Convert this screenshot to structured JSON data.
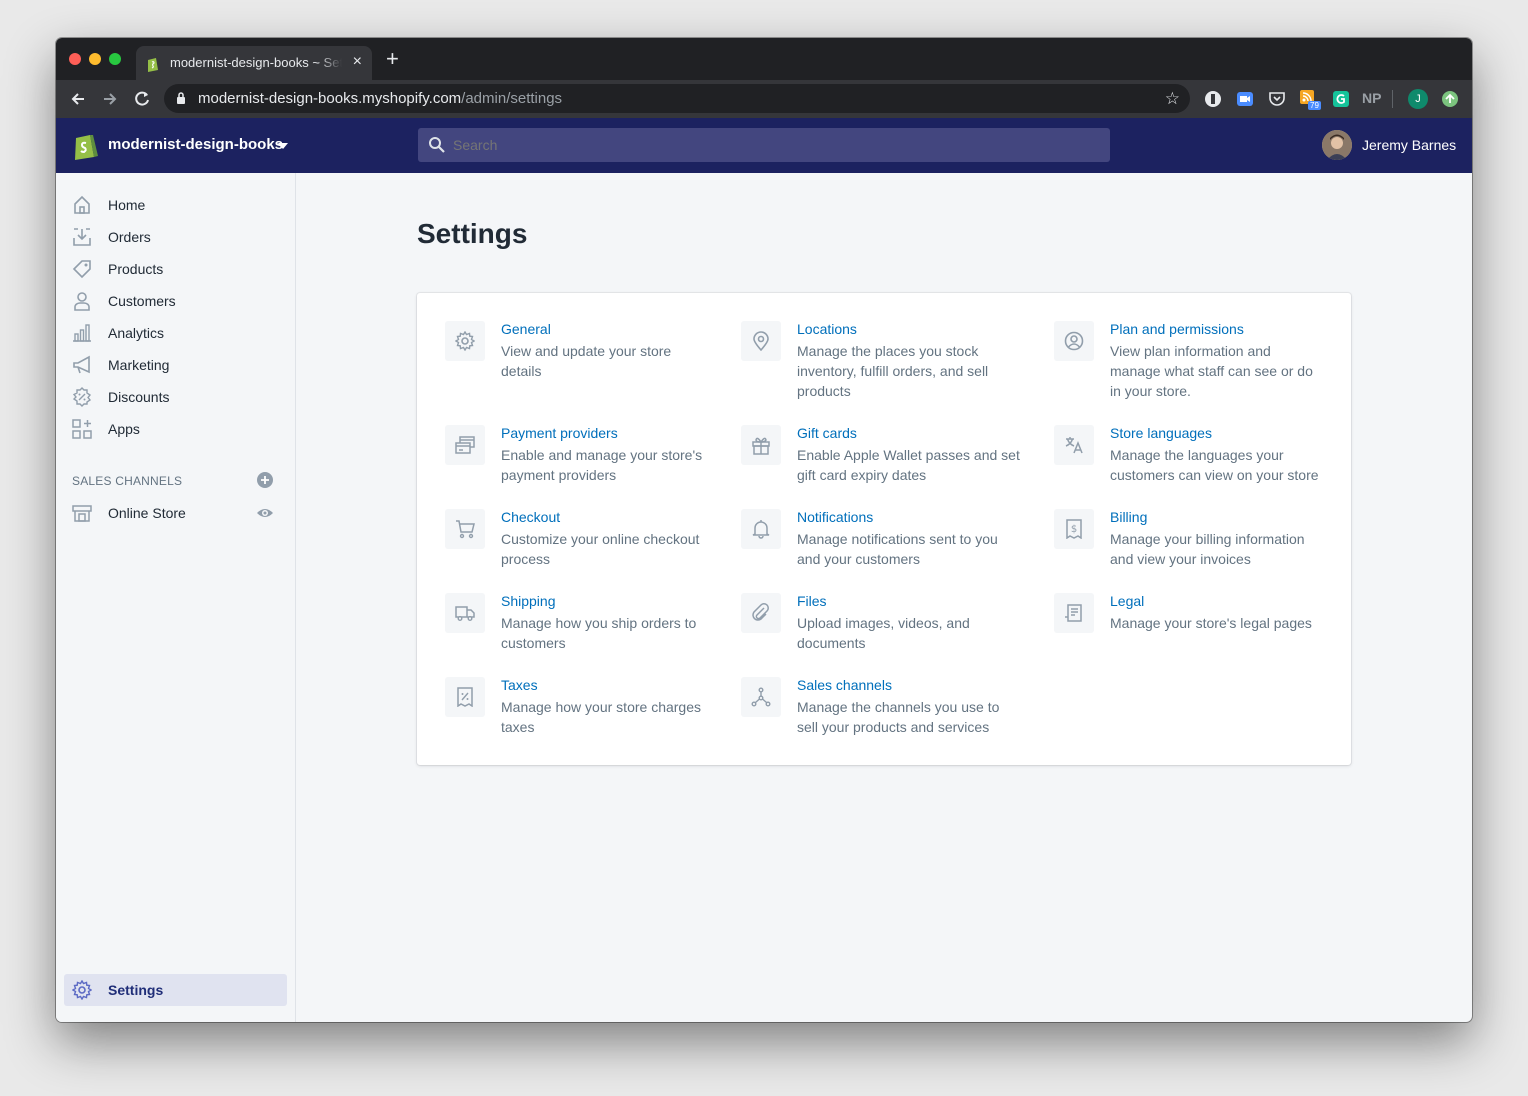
{
  "browser": {
    "tab_title": "modernist-design-books ~ Settings",
    "url_host": "modernist-design-books.myshopify.com",
    "url_path": "/admin/settings",
    "extension_badge": "79",
    "extension_np": "NP",
    "profile_initial": "J"
  },
  "topbar": {
    "store_name": "modernist-design-books",
    "search_placeholder": "Search",
    "user_name": "Jeremy Barnes"
  },
  "sidebar": {
    "items": [
      {
        "label": "Home",
        "icon": "home-icon"
      },
      {
        "label": "Orders",
        "icon": "orders-icon"
      },
      {
        "label": "Products",
        "icon": "tag-icon"
      },
      {
        "label": "Customers",
        "icon": "person-icon"
      },
      {
        "label": "Analytics",
        "icon": "bar-chart-icon"
      },
      {
        "label": "Marketing",
        "icon": "megaphone-icon"
      },
      {
        "label": "Discounts",
        "icon": "discount-icon"
      },
      {
        "label": "Apps",
        "icon": "apps-icon"
      }
    ],
    "sales_channels_heading": "SALES CHANNELS",
    "online_store": "Online Store",
    "settings": "Settings"
  },
  "page": {
    "title": "Settings"
  },
  "settings": [
    {
      "title": "General",
      "desc": "View and update your store details",
      "icon": "gear-icon"
    },
    {
      "title": "Locations",
      "desc": "Manage the places you stock inventory, fulfill orders, and sell products",
      "icon": "location-pin-icon"
    },
    {
      "title": "Plan and permissions",
      "desc": "View plan information and manage what staff can see or do in your store.",
      "icon": "user-circle-icon"
    },
    {
      "title": "Payment providers",
      "desc": "Enable and manage your store's payment providers",
      "icon": "credit-card-icon"
    },
    {
      "title": "Gift cards",
      "desc": "Enable Apple Wallet passes and set gift card expiry dates",
      "icon": "gift-icon"
    },
    {
      "title": "Store languages",
      "desc": "Manage the languages your customers can view on your store",
      "icon": "translate-icon"
    },
    {
      "title": "Checkout",
      "desc": "Customize your online checkout process",
      "icon": "cart-icon"
    },
    {
      "title": "Notifications",
      "desc": "Manage notifications sent to you and your customers",
      "icon": "bell-icon"
    },
    {
      "title": "Billing",
      "desc": "Manage your billing information and view your invoices",
      "icon": "billing-icon"
    },
    {
      "title": "Shipping",
      "desc": "Manage how you ship orders to customers",
      "icon": "truck-icon"
    },
    {
      "title": "Files",
      "desc": "Upload images, videos, and documents",
      "icon": "paperclip-icon"
    },
    {
      "title": "Legal",
      "desc": "Manage your store's legal pages",
      "icon": "legal-icon"
    },
    {
      "title": "Taxes",
      "desc": "Manage how your store charges taxes",
      "icon": "tax-icon"
    },
    {
      "title": "Sales channels",
      "desc": "Manage the channels you use to sell your products and services",
      "icon": "channels-icon"
    }
  ]
}
